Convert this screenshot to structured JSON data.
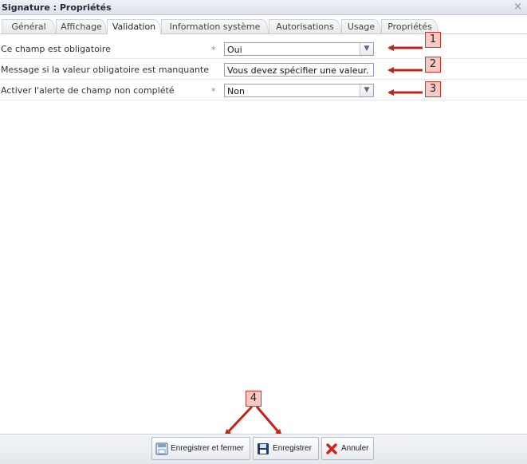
{
  "window": {
    "title": "Signature : Propriétés",
    "close_glyph": "×"
  },
  "tabs": [
    {
      "label": "Général",
      "active": false
    },
    {
      "label": "Affichage",
      "active": false
    },
    {
      "label": "Validation",
      "active": true
    },
    {
      "label": "Information système",
      "active": false
    },
    {
      "label": "Autorisations",
      "active": false
    },
    {
      "label": "Usage",
      "active": false
    },
    {
      "label": "Propriétés",
      "active": false
    }
  ],
  "form": {
    "rows": [
      {
        "label": "Ce champ est obligatoire",
        "required_mark": "*",
        "type": "select",
        "value": "Oui"
      },
      {
        "label": "Message si la valeur obligatoire est manquante",
        "required_mark": "",
        "type": "text",
        "value": "Vous devez spécifier une valeur."
      },
      {
        "label": "Activer l'alerte de champ non complété",
        "required_mark": "*",
        "type": "select",
        "value": "Non"
      }
    ]
  },
  "callouts": [
    "1",
    "2",
    "3",
    "4"
  ],
  "footer": {
    "save_close_label": "Enregistrer et fermer",
    "save_label": "Enregistrer",
    "cancel_label": "Annuler"
  },
  "icons": {
    "dropdown": "chevron-down-icon",
    "save_close": "save-close-icon",
    "save": "floppy-disk-icon",
    "cancel": "red-x-icon"
  },
  "colors": {
    "callout_red": "#c0241a",
    "callout_fill": "#f7c9c4",
    "field_border": "#8aa4c6"
  }
}
